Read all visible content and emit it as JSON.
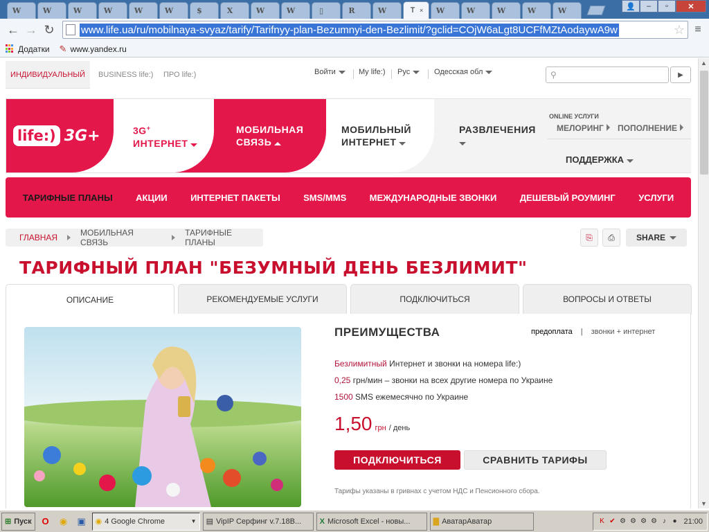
{
  "browser": {
    "tabs": [
      {
        "icon": "W"
      },
      {
        "icon": "W"
      },
      {
        "icon": "W"
      },
      {
        "icon": "W"
      },
      {
        "icon": "W"
      },
      {
        "icon": "W"
      },
      {
        "icon": "$"
      },
      {
        "icon": "X"
      },
      {
        "icon": "W"
      },
      {
        "icon": "W"
      },
      {
        "icon": "▯"
      },
      {
        "icon": "R"
      },
      {
        "icon": "W"
      }
    ],
    "active_tab": {
      "title": "T",
      "close": "×"
    },
    "tabs_after": [
      {
        "icon": "W"
      },
      {
        "icon": "W"
      },
      {
        "icon": "W"
      },
      {
        "icon": "W"
      },
      {
        "icon": "W"
      }
    ],
    "url": "www.life.ua/ru/mobilnaya-svyaz/tarify/Tarifnyy-plan-Bezumnyi-den-Bezlimit/?gclid=COjW6aLgt8UCFfMZtAodaywA9w",
    "window_controls": {
      "user": "👤",
      "min": "–",
      "max": "▫",
      "close": "✕"
    },
    "bookmarks": [
      "Додатки",
      "www.yandex.ru"
    ]
  },
  "topnav": {
    "segments": [
      "ИНДИВИДУАЛЬНЫЙ",
      "BUSINESS life:)",
      "ПРО life:)"
    ],
    "login": "Войти",
    "mylife": "My life:)",
    "lang": "Рус",
    "region": "Одесская обл",
    "search_placeholder": ""
  },
  "mainnav": {
    "logo_text": "life:)",
    "logo_3g": "3G+",
    "items": {
      "internet_3g_line1": "3G",
      "internet_3g_sup": "+",
      "internet_3g_line2": "ИНТЕРНЕТ",
      "mobile_line1": "МОБИЛЬНАЯ",
      "mobile_line2": "СВЯЗЬ",
      "mobinet_line1": "МОБИЛЬНЫЙ",
      "mobinet_line2": "ИНТЕРНЕТ",
      "fun": "РАЗВЛЕЧЕНИЯ"
    },
    "online_label": "ONLINE УСЛУГИ",
    "melody": "МЕЛОРИНГ",
    "topup": "ПОПОЛНЕНИЕ",
    "support": "ПОДДЕРЖКА"
  },
  "subnav": [
    "ТАРИФНЫЕ ПЛАНЫ",
    "АКЦИИ",
    "ИНТЕРНЕТ ПАКЕТЫ",
    "SMS/MMS",
    "МЕЖДУНАРОДНЫЕ ЗВОНКИ",
    "ДЕШЕВЫЙ РОУМИНГ",
    "УСЛУГИ"
  ],
  "breadcrumbs": [
    "ГЛАВНАЯ",
    "МОБИЛЬНАЯ СВЯЗЬ",
    "ТАРИФНЫЕ ПЛАНЫ"
  ],
  "share_label": "SHARE",
  "page_title": "ТАРИФНЫЙ ПЛАН \"БЕЗУМНЫЙ ДЕНЬ БЕЗЛИМИТ\"",
  "page_tabs": [
    "ОПИСАНИЕ",
    "РЕКОМЕНДУЕМЫЕ УСЛУГИ",
    "ПОДКЛЮЧИТЬСЯ",
    "ВОПРОСЫ И ОТВЕТЫ"
  ],
  "advantages": {
    "title": "ПРЕИМУЩЕСТВА",
    "mode_prepaid": "предоплата",
    "mode_sep": "|",
    "mode_calls": "звонки + интернет",
    "features": [
      {
        "hl": "Безлимитный",
        "text": " Интернет и звонки на номера life:)"
      },
      {
        "hl": "0,25",
        "text": " грн/мин – звонки на всех другие номера по Украине"
      },
      {
        "hl": "1500",
        "text": " SMS ежемесячно по Украине"
      }
    ],
    "price": "1,50",
    "currency": "грн",
    "per": "/ день",
    "connect_btn": "ПОДКЛЮЧИТЬСЯ",
    "compare_btn": "СРАВНИТЬ ТАРИФЫ",
    "note": "Тарифы указаны в гривнах с учетом НДС и Пенсионного сбора."
  },
  "taskbar": {
    "start": "Пуск",
    "buttons": [
      "4 Google Chrome",
      "VipIP Серфинг v.7.18B...",
      "Microsoft Excel - новы...",
      "АватарАватар"
    ],
    "clock": "21:00"
  },
  "colors": {
    "brand": "#e3174a",
    "title": "#c8102e"
  }
}
